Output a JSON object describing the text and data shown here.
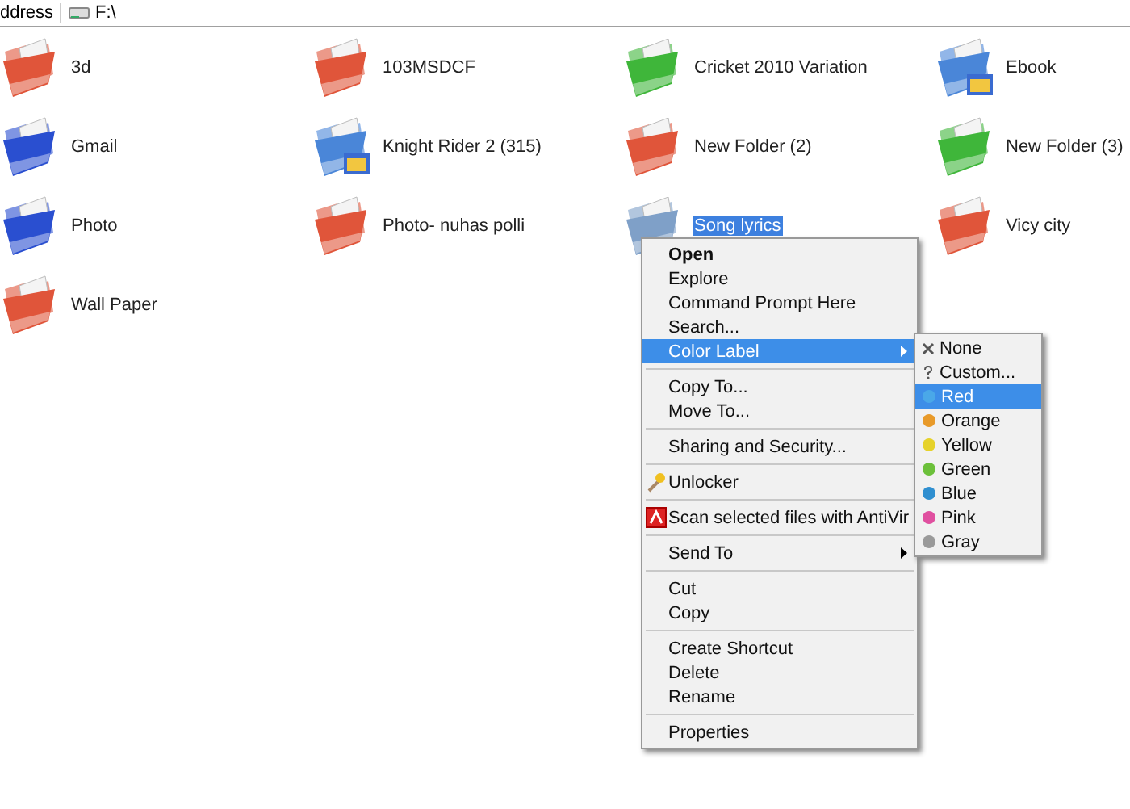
{
  "address_bar": {
    "label": "ddress",
    "value": "F:\\"
  },
  "folders": [
    {
      "name": "3d",
      "color": "#e0553a",
      "kind": "plain",
      "selected": false
    },
    {
      "name": "103MSDCF",
      "color": "#e0553a",
      "kind": "plain",
      "selected": false
    },
    {
      "name": "Cricket 2010 Variation",
      "color": "#3fb63a",
      "kind": "plain",
      "selected": false
    },
    {
      "name": "Ebook",
      "color": "#4a86d8",
      "kind": "media",
      "selected": false
    },
    {
      "name": "Gmail",
      "color": "#2a4fd0",
      "kind": "plain",
      "selected": false
    },
    {
      "name": "Knight Rider 2 (315)",
      "color": "#4a86d8",
      "kind": "media",
      "selected": false
    },
    {
      "name": "New Folder (2)",
      "color": "#e0553a",
      "kind": "plain",
      "selected": false
    },
    {
      "name": "New Folder (3)",
      "color": "#3fb63a",
      "kind": "plain",
      "selected": false
    },
    {
      "name": "Photo",
      "color": "#2a4fd0",
      "kind": "plain",
      "selected": false
    },
    {
      "name": "Photo- nuhas polli",
      "color": "#e0553a",
      "kind": "plain",
      "selected": false
    },
    {
      "name": "Song lyrics",
      "color": "#7fa0c8",
      "kind": "plain",
      "selected": true
    },
    {
      "name": "Vicy city",
      "color": "#e0553a",
      "kind": "plain",
      "selected": false
    },
    {
      "name": "Wall Paper",
      "color": "#e0553a",
      "kind": "plain",
      "selected": false
    }
  ],
  "context_menu": {
    "groups": [
      [
        {
          "label": "Open",
          "default": true,
          "selected": false,
          "submenu": false,
          "kind": "plain"
        },
        {
          "label": "Explore",
          "default": false,
          "selected": false,
          "submenu": false,
          "kind": "plain"
        },
        {
          "label": "Command Prompt Here",
          "default": false,
          "selected": false,
          "submenu": false,
          "kind": "plain"
        },
        {
          "label": "Search...",
          "default": false,
          "selected": false,
          "submenu": false,
          "kind": "plain"
        },
        {
          "label": "Color Label",
          "default": false,
          "selected": true,
          "submenu": true,
          "kind": "plain"
        }
      ],
      [
        {
          "label": "Copy To...",
          "default": false,
          "selected": false,
          "submenu": false,
          "kind": "plain"
        },
        {
          "label": "Move To...",
          "default": false,
          "selected": false,
          "submenu": false,
          "kind": "plain"
        }
      ],
      [
        {
          "label": "Sharing and Security...",
          "default": false,
          "selected": false,
          "submenu": false,
          "kind": "plain"
        }
      ],
      [
        {
          "label": "Unlocker",
          "default": false,
          "selected": false,
          "submenu": false,
          "kind": "wand"
        }
      ],
      [
        {
          "label": "Scan selected files with AntiVir",
          "default": false,
          "selected": false,
          "submenu": false,
          "kind": "antivirus"
        }
      ],
      [
        {
          "label": "Send To",
          "default": false,
          "selected": false,
          "submenu": true,
          "kind": "plain"
        }
      ],
      [
        {
          "label": "Cut",
          "default": false,
          "selected": false,
          "submenu": false,
          "kind": "plain"
        },
        {
          "label": "Copy",
          "default": false,
          "selected": false,
          "submenu": false,
          "kind": "plain"
        }
      ],
      [
        {
          "label": "Create Shortcut",
          "default": false,
          "selected": false,
          "submenu": false,
          "kind": "plain"
        },
        {
          "label": "Delete",
          "default": false,
          "selected": false,
          "submenu": false,
          "kind": "plain"
        },
        {
          "label": "Rename",
          "default": false,
          "selected": false,
          "submenu": false,
          "kind": "plain"
        }
      ],
      [
        {
          "label": "Properties",
          "default": false,
          "selected": false,
          "submenu": false,
          "kind": "plain"
        }
      ]
    ]
  },
  "color_submenu": [
    {
      "label": "None",
      "kind": "cross",
      "selected": false
    },
    {
      "label": "Custom...",
      "kind": "question",
      "selected": false
    },
    {
      "label": "Red",
      "kind": "dot",
      "color": "#4aa8e8",
      "selected": true
    },
    {
      "label": "Orange",
      "kind": "dot",
      "color": "#e89a2a",
      "selected": false
    },
    {
      "label": "Yellow",
      "kind": "dot",
      "color": "#e6d22a",
      "selected": false
    },
    {
      "label": "Green",
      "kind": "dot",
      "color": "#6cc03a",
      "selected": false
    },
    {
      "label": "Blue",
      "kind": "dot",
      "color": "#2f8fd0",
      "selected": false
    },
    {
      "label": "Pink",
      "kind": "dot",
      "color": "#e050a0",
      "selected": false
    },
    {
      "label": "Gray",
      "kind": "dot",
      "color": "#9a9a9a",
      "selected": false
    }
  ]
}
